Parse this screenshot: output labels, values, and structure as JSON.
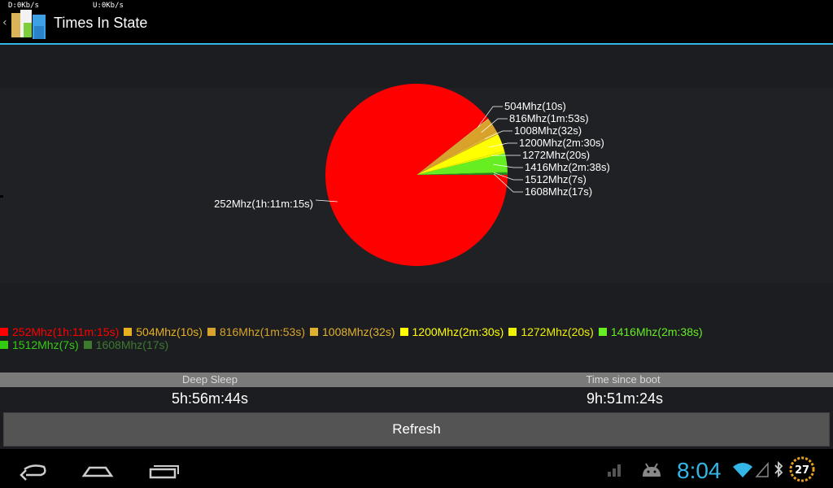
{
  "statusbar": {
    "download": "D:0Kb/s",
    "upload": "U:0Kb/s"
  },
  "actionbar": {
    "title": "Times In State"
  },
  "colors": {
    "accent": "#33b5e5"
  },
  "chart_data": {
    "type": "pie",
    "title": "",
    "slices": [
      {
        "label": "252Mhz(1h:11m:15s)",
        "value": 4275,
        "color": "#ff0000"
      },
      {
        "label": "504Mhz(10s)",
        "value": 10,
        "color": "#e8c24a"
      },
      {
        "label": "816Mhz(1m:53s)",
        "value": 113,
        "color": "#d9a32b"
      },
      {
        "label": "1008Mhz(32s)",
        "value": 32,
        "color": "#e0b030"
      },
      {
        "label": "1200Mhz(2m:30s)",
        "value": 150,
        "color": "#ffff00"
      },
      {
        "label": "1272Mhz(20s)",
        "value": 20,
        "color": "#e6ff00"
      },
      {
        "label": "1416Mhz(2m:38s)",
        "value": 158,
        "color": "#66ee22"
      },
      {
        "label": "1512Mhz(7s)",
        "value": 7,
        "color": "#33cc11"
      },
      {
        "label": "1608Mhz(17s)",
        "value": 17,
        "color": "#2e7d22"
      }
    ]
  },
  "legend": {
    "row1": [
      {
        "label": "252Mhz(1h:11m:15s)",
        "color": "#ff0000"
      },
      {
        "label": "504Mhz(10s)",
        "color": "#e8b020"
      },
      {
        "label": "816Mhz(1m:53s)",
        "color": "#d9a32b"
      },
      {
        "label": "1008Mhz(32s)",
        "color": "#e0b030"
      },
      {
        "label": "1200Mhz(2m:30s)",
        "color": "#ffff00"
      },
      {
        "label": "1272Mhz(20s)",
        "color": "#f0f000"
      },
      {
        "label": "1416Mhz(2m:38s)",
        "color": "#66ee22"
      }
    ],
    "row2": [
      {
        "label": "1512Mhz(7s)",
        "color": "#33cc11"
      },
      {
        "label": "1608Mhz(17s)",
        "color": "#3c7a2e"
      }
    ]
  },
  "stats": {
    "deep_sleep_label": "Deep Sleep",
    "deep_sleep_value": "5h:56m:44s",
    "since_boot_label": "Time since boot",
    "since_boot_value": "9h:51m:24s"
  },
  "refresh_label": "Refresh",
  "systembar": {
    "time": "8:04",
    "battery": "27"
  }
}
